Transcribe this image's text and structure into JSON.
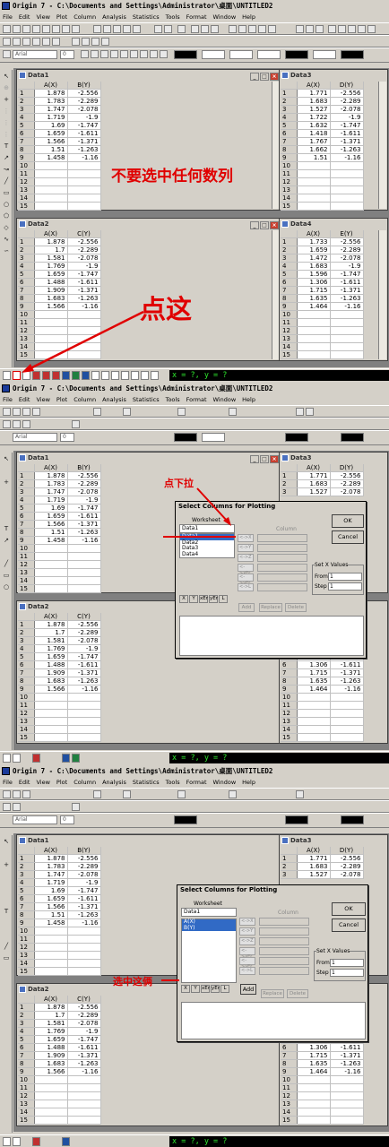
{
  "app": {
    "title": "Origin 7 - C:\\Documents and Settings\\Administrator\\桌面\\UNTITLED2"
  },
  "menu": [
    "File",
    "Edit",
    "View",
    "Plot",
    "Column",
    "Analysis",
    "Statistics",
    "Tools",
    "Format",
    "Window",
    "Help"
  ],
  "toolbar": {
    "font_name": "Arial",
    "size_value": "0"
  },
  "status": {
    "coord_readout": "x = ?, y = ?"
  },
  "worksheets": {
    "data1": {
      "title": "Data1",
      "col1": "A(X)",
      "col2": "B(Y)",
      "row_labels": [
        "1",
        "2",
        "3",
        "4",
        "5",
        "6",
        "7",
        "8",
        "9",
        "10",
        "11",
        "12",
        "13",
        "14",
        "15"
      ],
      "rows": [
        [
          "1.878",
          "-2.556"
        ],
        [
          "1.783",
          "-2.289"
        ],
        [
          "1.747",
          "-2.078"
        ],
        [
          "1.719",
          "-1.9"
        ],
        [
          "1.69",
          "-1.747"
        ],
        [
          "1.659",
          "-1.611"
        ],
        [
          "1.566",
          "-1.371"
        ],
        [
          "1.51",
          "-1.263"
        ],
        [
          "1.458",
          "-1.16"
        ]
      ]
    },
    "data2": {
      "title": "Data2",
      "col1": "A(X)",
      "col2": "C(Y)",
      "rows": [
        [
          "1.878",
          "-2.556"
        ],
        [
          "1.7",
          "-2.289"
        ],
        [
          "1.581",
          "-2.078"
        ],
        [
          "1.769",
          "-1.9"
        ],
        [
          "1.659",
          "-1.747"
        ],
        [
          "1.488",
          "-1.611"
        ],
        [
          "1.909",
          "-1.371"
        ],
        [
          "1.683",
          "-1.263"
        ],
        [
          "1.566",
          "-1.16"
        ]
      ]
    },
    "data3": {
      "title": "Data3",
      "col1": "A(X)",
      "col2": "D(Y)",
      "rows": [
        [
          "1.771",
          "-2.556"
        ],
        [
          "1.683",
          "-2.289"
        ],
        [
          "1.527",
          "-2.078"
        ],
        [
          "1.722",
          "-1.9"
        ],
        [
          "1.632",
          "-1.747"
        ],
        [
          "1.418",
          "-1.611"
        ],
        [
          "1.767",
          "-1.371"
        ],
        [
          "1.662",
          "-1.263"
        ],
        [
          "1.51",
          "-1.16"
        ]
      ]
    },
    "data4": {
      "title": "Data4",
      "col1": "A(X)",
      "col2": "E(Y)",
      "rows": [
        [
          "1.733",
          "-2.556"
        ],
        [
          "1.659",
          "-2.289"
        ],
        [
          "1.472",
          "-2.078"
        ],
        [
          "1.683",
          "-1.9"
        ],
        [
          "1.596",
          "-1.747"
        ],
        [
          "1.306",
          "-1.611"
        ],
        [
          "1.715",
          "-1.371"
        ],
        [
          "1.635",
          "-1.263"
        ],
        [
          "1.464",
          "-1.16"
        ]
      ]
    }
  },
  "annotations": {
    "no_select": "不要选中任何数列",
    "click_here": "点这",
    "click_dropdown": "点下拉",
    "select_these": "选中这俩"
  },
  "dialog": {
    "title": "Select Columns for Plotting",
    "worksheet_label": "Worksheet",
    "worksheet_value": "Data1",
    "worksheet_options": [
      "Data1",
      "Data2",
      "Data3",
      "Data4"
    ],
    "column_label": "Column",
    "columns": [
      "A(X)",
      "B(Y)"
    ],
    "ok": "OK",
    "cancel": "Cancel",
    "setx_label": "Set X Values",
    "from_label": "From",
    "from_value": "1",
    "step_label": "Step",
    "step_value": "1",
    "add": "Add",
    "replace": "Replace",
    "delete": "Delete",
    "role_buttons": [
      "<->X",
      "<->Y",
      "<->Z",
      "<->xEr",
      "<->yEr",
      "<->L"
    ],
    "tool_buttons": [
      "X",
      "Y",
      "xEr",
      "yEr",
      "L"
    ]
  },
  "colors": {
    "accent_red": "#e00000",
    "coord_green": "#2eea2e",
    "selection": "#316ac5"
  }
}
